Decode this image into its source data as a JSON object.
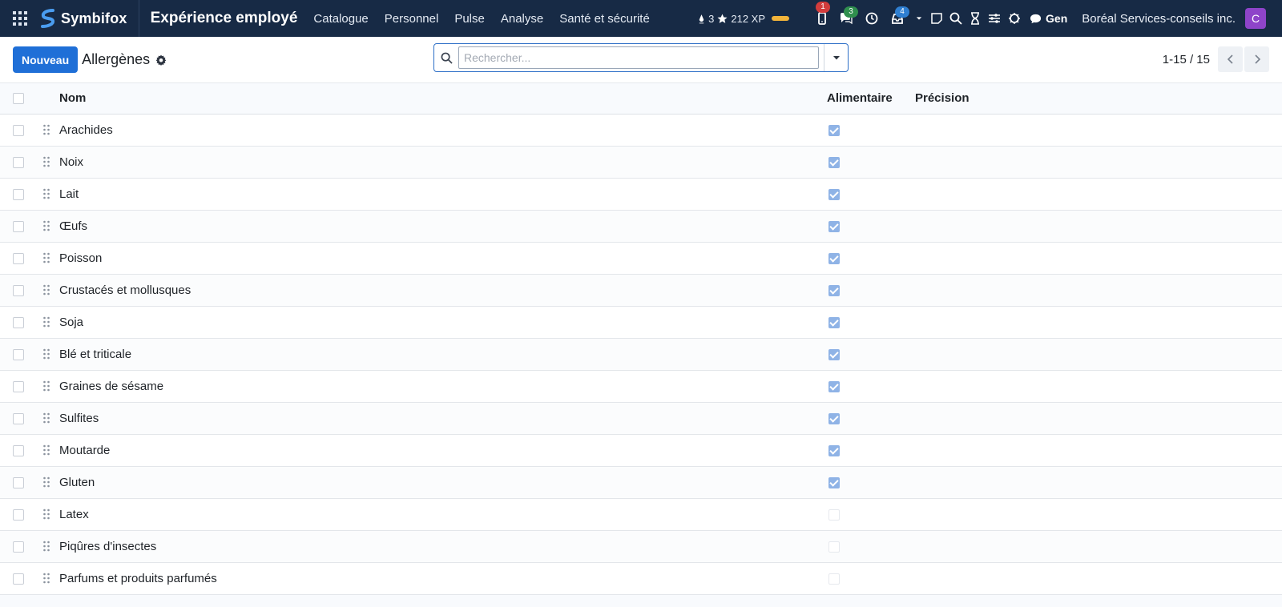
{
  "navbar": {
    "brand": "Symbifox",
    "app_title": "Expérience employé",
    "menu": [
      "Catalogue",
      "Personnel",
      "Pulse",
      "Analyse",
      "Santé et sécurité"
    ],
    "gamification": {
      "drops": "3",
      "xp": "212 XP"
    },
    "badges": {
      "phone": "1",
      "chat": "3",
      "inbox": "4"
    },
    "gen_label": "Gen",
    "company": "Boréal Services-conseils inc.",
    "avatar_letter": "C"
  },
  "control": {
    "new_button": "Nouveau",
    "title": "Allergènes",
    "search_placeholder": "Rechercher...",
    "pager": "1-15 / 15"
  },
  "table": {
    "columns": {
      "name": "Nom",
      "alimentaire": "Alimentaire",
      "precision": "Précision"
    },
    "rows": [
      {
        "name": "Arachides",
        "alimentaire": true
      },
      {
        "name": "Noix",
        "alimentaire": true
      },
      {
        "name": "Lait",
        "alimentaire": true
      },
      {
        "name": "Œufs",
        "alimentaire": true
      },
      {
        "name": "Poisson",
        "alimentaire": true
      },
      {
        "name": "Crustacés et mollusques",
        "alimentaire": true
      },
      {
        "name": "Soja",
        "alimentaire": true
      },
      {
        "name": "Blé et triticale",
        "alimentaire": true
      },
      {
        "name": "Graines de sésame",
        "alimentaire": true
      },
      {
        "name": "Sulfites",
        "alimentaire": true
      },
      {
        "name": "Moutarde",
        "alimentaire": true
      },
      {
        "name": "Gluten",
        "alimentaire": true
      },
      {
        "name": "Latex",
        "alimentaire": false
      },
      {
        "name": "Piqûres d'insectes",
        "alimentaire": false
      },
      {
        "name": "Parfums et produits parfumés",
        "alimentaire": false
      }
    ]
  },
  "colors": {
    "navbar": "#172a45",
    "primary": "#1f6fd7",
    "checked": "#8fb3e6"
  }
}
